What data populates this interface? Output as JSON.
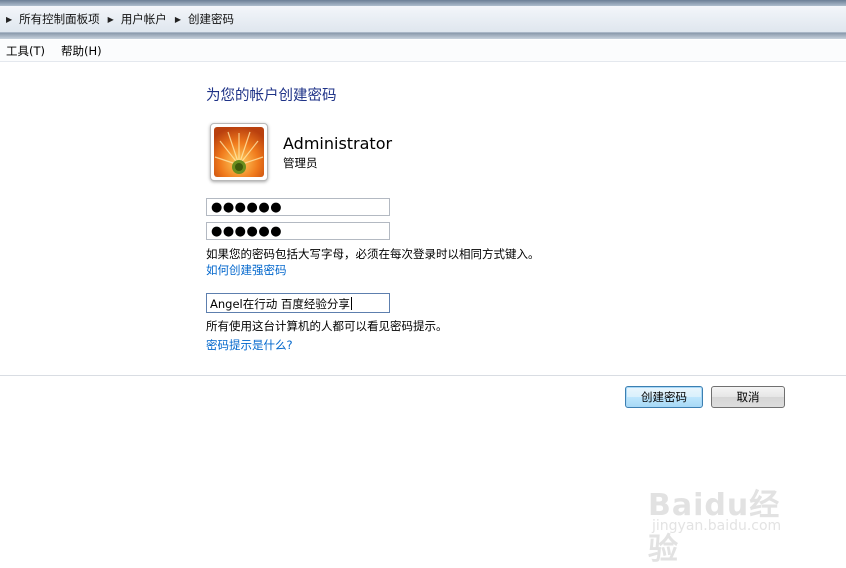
{
  "breadcrumb": {
    "items": [
      "所有控制面板项",
      "用户帐户",
      "创建密码"
    ]
  },
  "menu": {
    "tools": "工具(T)",
    "help": "帮助(H)"
  },
  "page": {
    "title": "为您的帐户创建密码"
  },
  "account": {
    "name": "Administrator",
    "role": "管理员",
    "avatar_icon": "orange-flower-icon"
  },
  "form": {
    "new_password_value": "●●●●●●",
    "confirm_password_value": "●●●●●●",
    "caps_note": "如果您的密码包括大写字母，必须在每次登录时以相同方式键入。",
    "strong_password_link": "如何创建强密码",
    "hint_value": "Angel在行动 百度经验分享",
    "hint_note": "所有使用这台计算机的人都可以看见密码提示。",
    "hint_link": "密码提示是什么?"
  },
  "buttons": {
    "create": "创建密码",
    "cancel": "取消"
  },
  "watermark": {
    "logo": "Baidu经验",
    "url": "jingyan.baidu.com"
  },
  "colors": {
    "title": "#1e3287",
    "link": "#0066cc",
    "primary_button_border": "#3c7fb1"
  }
}
